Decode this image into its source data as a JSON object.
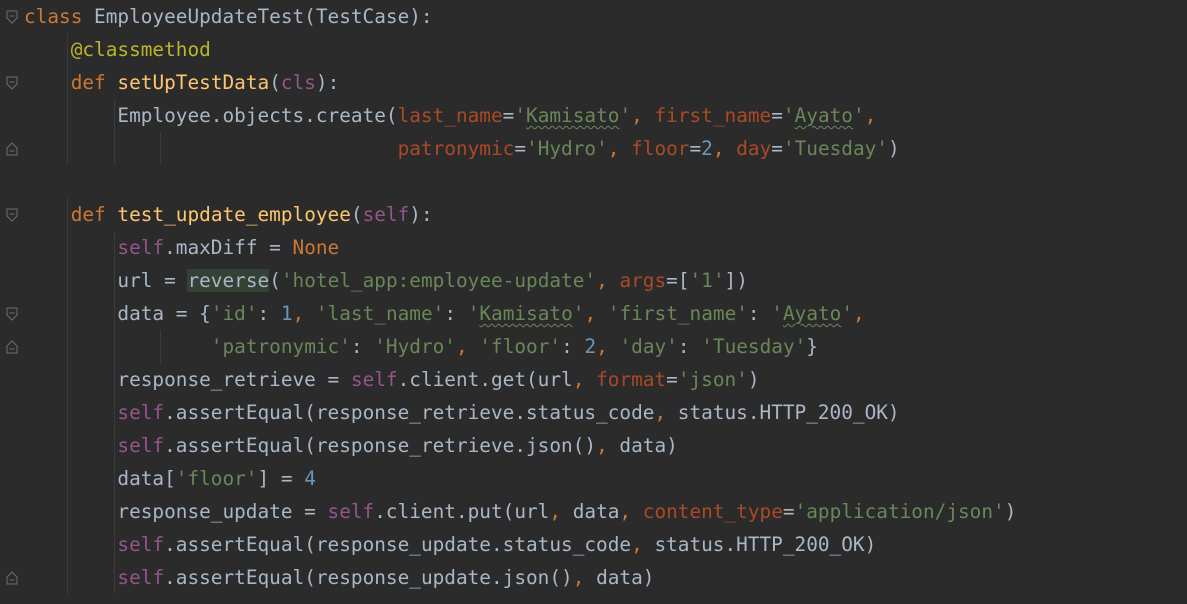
{
  "editor": {
    "lines": [
      [
        {
          "t": "class",
          "c": "kw"
        },
        {
          "t": " EmployeeUpdateTest(TestCase):",
          "c": "op"
        }
      ],
      [
        {
          "t": "    "
        },
        {
          "t": "@classmethod",
          "c": "dec"
        }
      ],
      [
        {
          "t": "    "
        },
        {
          "t": "def",
          "c": "kw"
        },
        {
          "t": " "
        },
        {
          "t": "setUpTestData",
          "c": "fn"
        },
        {
          "t": "("
        },
        {
          "t": "cls",
          "c": "self"
        },
        {
          "t": "):"
        }
      ],
      [
        {
          "t": "        Employee.objects.create("
        },
        {
          "t": "last_name",
          "c": "param"
        },
        {
          "t": "="
        },
        {
          "t": "'",
          "c": "str"
        },
        {
          "t": "Kamisato",
          "c": "str typo"
        },
        {
          "t": "'",
          "c": "str"
        },
        {
          "t": ", ",
          "c": "kw"
        },
        {
          "t": "first_name",
          "c": "param"
        },
        {
          "t": "="
        },
        {
          "t": "'",
          "c": "str"
        },
        {
          "t": "Ayato",
          "c": "str typo"
        },
        {
          "t": "'",
          "c": "str"
        },
        {
          "t": ",",
          "c": "kw"
        }
      ],
      [
        {
          "t": "                                "
        },
        {
          "t": "patronymic",
          "c": "param"
        },
        {
          "t": "="
        },
        {
          "t": "'Hydro'",
          "c": "str"
        },
        {
          "t": ", ",
          "c": "kw"
        },
        {
          "t": "floor",
          "c": "param"
        },
        {
          "t": "="
        },
        {
          "t": "2",
          "c": "num"
        },
        {
          "t": ", ",
          "c": "kw"
        },
        {
          "t": "day",
          "c": "param"
        },
        {
          "t": "="
        },
        {
          "t": "'Tuesday'",
          "c": "str"
        },
        {
          "t": ")"
        }
      ],
      [],
      [
        {
          "t": "    "
        },
        {
          "t": "def",
          "c": "kw"
        },
        {
          "t": " "
        },
        {
          "t": "test_update_employee",
          "c": "fn"
        },
        {
          "t": "("
        },
        {
          "t": "self",
          "c": "self"
        },
        {
          "t": "):"
        }
      ],
      [
        {
          "t": "        "
        },
        {
          "t": "self",
          "c": "self"
        },
        {
          "t": ".maxDiff = "
        },
        {
          "t": "None",
          "c": "none"
        }
      ],
      [
        {
          "t": "        url = "
        },
        {
          "t": "reverse",
          "c": "hl"
        },
        {
          "t": "("
        },
        {
          "t": "'hotel_app:employee-update'",
          "c": "str"
        },
        {
          "t": ", ",
          "c": "kw"
        },
        {
          "t": "args",
          "c": "param"
        },
        {
          "t": "=["
        },
        {
          "t": "'1'",
          "c": "str"
        },
        {
          "t": "])"
        }
      ],
      [
        {
          "t": "        data = {"
        },
        {
          "t": "'id'",
          "c": "str"
        },
        {
          "t": ": "
        },
        {
          "t": "1",
          "c": "num"
        },
        {
          "t": ", ",
          "c": "kw"
        },
        {
          "t": "'last_name'",
          "c": "str"
        },
        {
          "t": ": "
        },
        {
          "t": "'",
          "c": "str"
        },
        {
          "t": "Kamisato",
          "c": "str typo"
        },
        {
          "t": "'",
          "c": "str"
        },
        {
          "t": ", ",
          "c": "kw"
        },
        {
          "t": "'first_name'",
          "c": "str"
        },
        {
          "t": ": "
        },
        {
          "t": "'",
          "c": "str"
        },
        {
          "t": "Ayato",
          "c": "str typo"
        },
        {
          "t": "'",
          "c": "str"
        },
        {
          "t": ",",
          "c": "kw"
        }
      ],
      [
        {
          "t": "                "
        },
        {
          "t": "'patronymic'",
          "c": "str"
        },
        {
          "t": ": "
        },
        {
          "t": "'Hydro'",
          "c": "str"
        },
        {
          "t": ", ",
          "c": "kw"
        },
        {
          "t": "'floor'",
          "c": "str"
        },
        {
          "t": ": "
        },
        {
          "t": "2",
          "c": "num"
        },
        {
          "t": ", ",
          "c": "kw"
        },
        {
          "t": "'day'",
          "c": "str"
        },
        {
          "t": ": "
        },
        {
          "t": "'Tuesday'",
          "c": "str"
        },
        {
          "t": "}"
        }
      ],
      [
        {
          "t": "        response_retrieve = "
        },
        {
          "t": "self",
          "c": "self"
        },
        {
          "t": ".client.get(url"
        },
        {
          "t": ", ",
          "c": "kw"
        },
        {
          "t": "format",
          "c": "param"
        },
        {
          "t": "="
        },
        {
          "t": "'json'",
          "c": "str"
        },
        {
          "t": ")"
        }
      ],
      [
        {
          "t": "        "
        },
        {
          "t": "self",
          "c": "self"
        },
        {
          "t": ".assertEqual(response_retrieve.status_code"
        },
        {
          "t": ", ",
          "c": "kw"
        },
        {
          "t": "status.HTTP_200_OK)"
        }
      ],
      [
        {
          "t": "        "
        },
        {
          "t": "self",
          "c": "self"
        },
        {
          "t": ".assertEqual(response_retrieve.json()"
        },
        {
          "t": ", ",
          "c": "kw"
        },
        {
          "t": "data)"
        }
      ],
      [
        {
          "t": "        data["
        },
        {
          "t": "'floor'",
          "c": "str"
        },
        {
          "t": "] = "
        },
        {
          "t": "4",
          "c": "num"
        }
      ],
      [
        {
          "t": "        response_update = "
        },
        {
          "t": "self",
          "c": "self"
        },
        {
          "t": ".client.put(url"
        },
        {
          "t": ", ",
          "c": "kw"
        },
        {
          "t": "data"
        },
        {
          "t": ", ",
          "c": "kw"
        },
        {
          "t": "content_type",
          "c": "param"
        },
        {
          "t": "="
        },
        {
          "t": "'application/json'",
          "c": "str"
        },
        {
          "t": ")"
        }
      ],
      [
        {
          "t": "        "
        },
        {
          "t": "self",
          "c": "self"
        },
        {
          "t": ".assertEqual(response_update.status_code"
        },
        {
          "t": ", ",
          "c": "kw"
        },
        {
          "t": "status.HTTP_200_OK)"
        }
      ],
      [
        {
          "t": "        "
        },
        {
          "t": "self",
          "c": "self"
        },
        {
          "t": ".assertEqual(response_update.json()"
        },
        {
          "t": ", ",
          "c": "kw"
        },
        {
          "t": "data)"
        }
      ]
    ],
    "folds": {
      "0": "open",
      "2": "open",
      "4": "close",
      "6": "open",
      "9": "open",
      "10": "close",
      "17": "close"
    },
    "guides": {
      "1": [
        1
      ],
      "2": [
        1
      ],
      "3": [
        1,
        2
      ],
      "4": [
        1,
        2,
        3
      ],
      "6": [
        1
      ],
      "7": [
        1,
        2
      ],
      "8": [
        1,
        2
      ],
      "9": [
        1,
        2
      ],
      "10": [
        1,
        2,
        3
      ],
      "11": [
        1,
        2
      ],
      "12": [
        1,
        2
      ],
      "13": [
        1,
        2
      ],
      "14": [
        1,
        2
      ],
      "15": [
        1,
        2
      ],
      "16": [
        1,
        2
      ],
      "17": [
        1,
        2
      ]
    }
  }
}
